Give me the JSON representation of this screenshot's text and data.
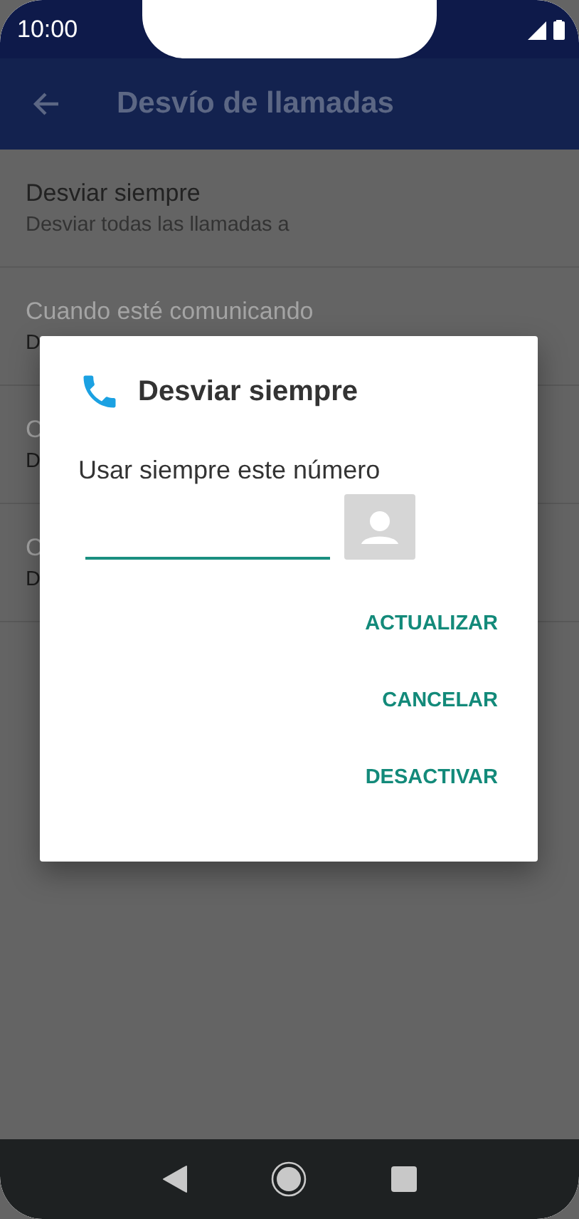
{
  "status_bar": {
    "time": "10:00"
  },
  "toolbar": {
    "title": "Desvío de llamadas"
  },
  "list": [
    {
      "title": "Desviar siempre",
      "subtitle": "Desviar todas las llamadas a",
      "disabled": false
    },
    {
      "title": "Cuando esté comunicando",
      "subtitle": "D",
      "disabled": true
    },
    {
      "title": "C",
      "subtitle": "D",
      "disabled": true
    },
    {
      "title": "C",
      "subtitle": "D",
      "disabled": true
    }
  ],
  "dialog": {
    "title": "Desviar siempre",
    "label": "Usar siempre este número",
    "buttons": [
      "ACTUALIZAR",
      "CANCELAR",
      "DESACTIVAR"
    ]
  }
}
